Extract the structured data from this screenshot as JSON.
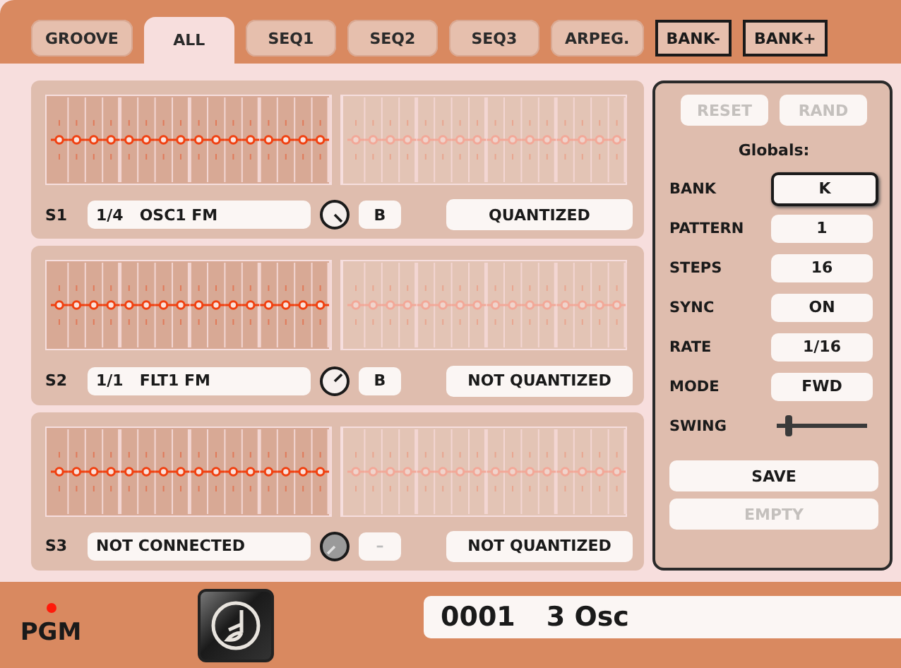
{
  "tabs": [
    {
      "label": "GROOVE",
      "selected": false
    },
    {
      "label": "ALL",
      "selected": true
    },
    {
      "label": "SEQ1",
      "selected": false
    },
    {
      "label": "SEQ2",
      "selected": false
    },
    {
      "label": "SEQ3",
      "selected": false
    },
    {
      "label": "ARPEG.",
      "selected": false
    }
  ],
  "bank_buttons": [
    "BANK-",
    "BANK+"
  ],
  "lanes": [
    {
      "name": "S1",
      "target": "1/4   OSC1 FM",
      "knob": {
        "disabled": false
      },
      "bank": "B",
      "quantize": "QUANTIZED"
    },
    {
      "name": "S2",
      "target": "1/1   FLT1 FM",
      "knob": {
        "disabled": false
      },
      "bank": "B",
      "quantize": "NOT QUANTIZED"
    },
    {
      "name": "S3",
      "target": "NOT CONNECTED",
      "knob": {
        "disabled": true
      },
      "bank": "–",
      "quantize": "NOT QUANTIZED"
    }
  ],
  "globals": {
    "reset": {
      "label": "RESET",
      "disabled": true
    },
    "rand": {
      "label": "RAND",
      "disabled": true
    },
    "title": "Globals:",
    "fields": [
      {
        "label": "BANK",
        "value": "K",
        "selected": true
      },
      {
        "label": "PATTERN",
        "value": "1",
        "selected": false
      },
      {
        "label": "STEPS",
        "value": "16",
        "selected": false
      },
      {
        "label": "SYNC",
        "value": "ON",
        "selected": false
      },
      {
        "label": "RATE",
        "value": "1/16",
        "selected": false
      },
      {
        "label": "MODE",
        "value": "FWD",
        "selected": false
      }
    ],
    "swing": {
      "label": "SWING",
      "level": 0.1
    },
    "save": {
      "label": "SAVE",
      "disabled": false
    },
    "empty": {
      "label": "EMPTY",
      "disabled": true
    }
  },
  "status_bar": {
    "led_on": true,
    "label": "PGM",
    "program_number": "0001",
    "program_name": "3 Osc"
  }
}
